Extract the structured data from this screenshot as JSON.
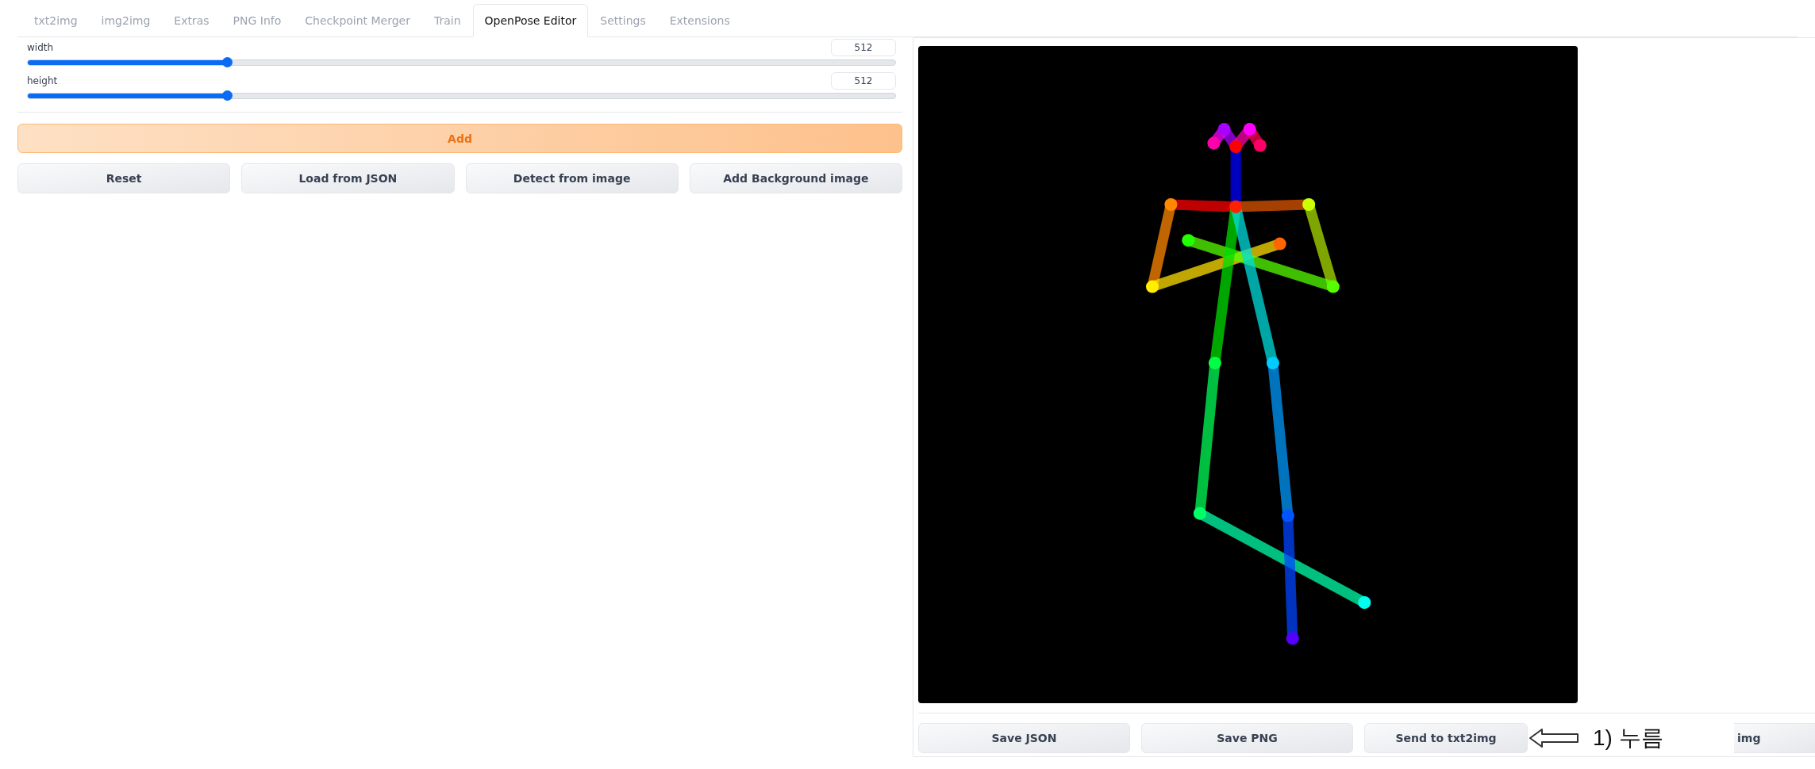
{
  "tabs": [
    {
      "label": "txt2img",
      "selected": false
    },
    {
      "label": "img2img",
      "selected": false
    },
    {
      "label": "Extras",
      "selected": false
    },
    {
      "label": "PNG Info",
      "selected": false
    },
    {
      "label": "Checkpoint Merger",
      "selected": false
    },
    {
      "label": "Train",
      "selected": false
    },
    {
      "label": "OpenPose Editor",
      "selected": true
    },
    {
      "label": "Settings",
      "selected": false
    },
    {
      "label": "Extensions",
      "selected": false
    }
  ],
  "sliders": [
    {
      "label": "width",
      "value": "512",
      "level": 0.23
    },
    {
      "label": "height",
      "value": "512",
      "level": 0.23
    }
  ],
  "add_button": "Add",
  "buttons": [
    "Reset",
    "Load from JSON",
    "Detect from image",
    "Add Background image"
  ],
  "bottom_buttons": [
    "Save JSON",
    "Save PNG",
    "Send to txt2img",
    "img"
  ],
  "annotation": {
    "text": "1) 누름"
  }
}
